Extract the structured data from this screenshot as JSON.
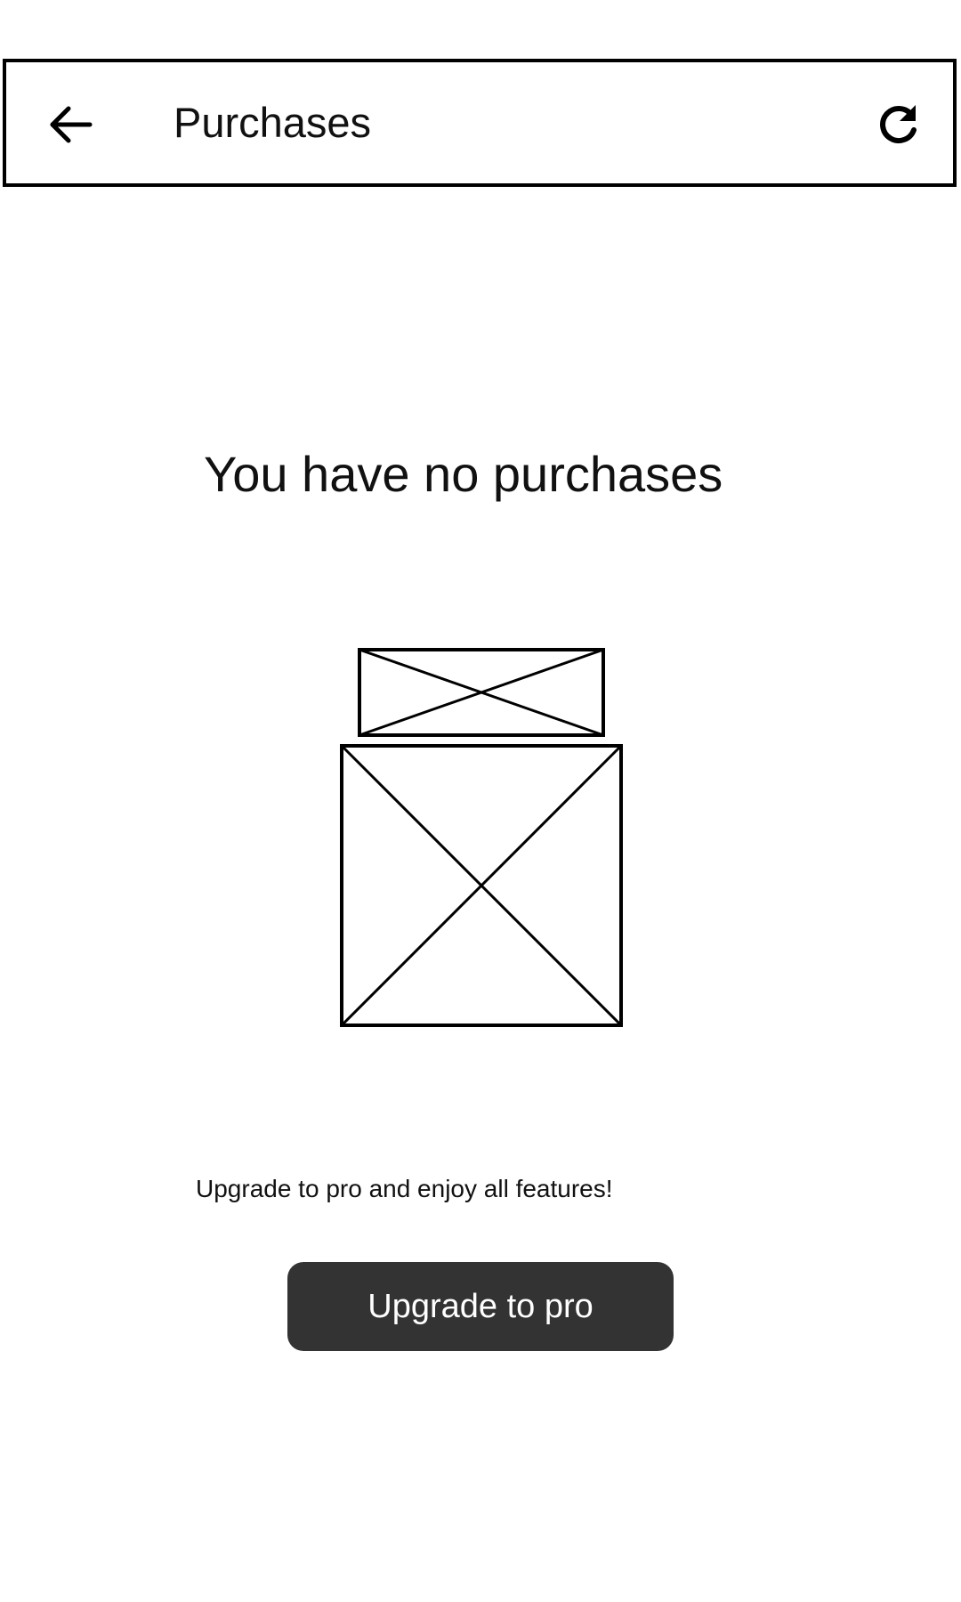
{
  "header": {
    "title": "Purchases",
    "back_icon": "arrow-left-icon",
    "refresh_icon": "refresh-icon"
  },
  "empty_state": {
    "title": "You have no purchases",
    "image_placeholders": [
      "image-placeholder",
      "image-placeholder"
    ]
  },
  "promo": {
    "text": "Upgrade to pro and enjoy all features!",
    "button_label": "Upgrade to pro"
  },
  "colors": {
    "button_bg": "#333333",
    "button_text": "#ffffff",
    "border": "#000000",
    "text": "#111111"
  }
}
